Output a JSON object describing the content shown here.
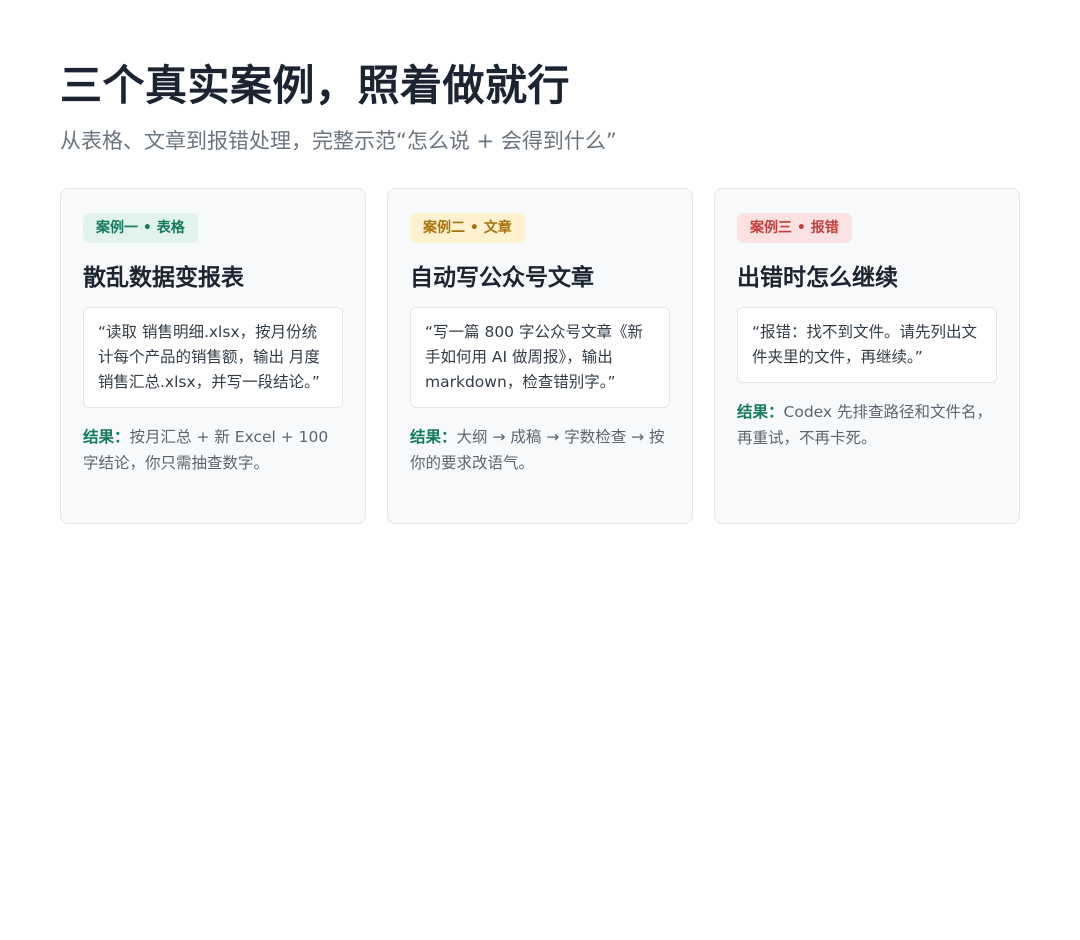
{
  "header": {
    "title": "三个真实案例，照着做就行",
    "subtitle": "从表格、文章到报错处理，完整示范“怎么说 + 会得到什么”"
  },
  "cards": [
    {
      "badge": "案例一 • 表格",
      "title": "散乱数据变报表",
      "quote": "“读取 销售明细.xlsx，按月份统计每个产品的销售额，输出 月度销售汇总.xlsx，并写一段结论。”",
      "result_label": "结果：",
      "result_text": "按月汇总 + 新 Excel + 100 字结论，你只需抽查数字。"
    },
    {
      "badge": "案例二 • 文章",
      "title": "自动写公众号文章",
      "quote": "“写一篇 800 字公众号文章《新手如何用 AI 做周报》，输出 markdown，检查错别字。”",
      "result_label": "结果：",
      "result_text": "大纲 → 成稿 → 字数检查 → 按你的要求改语气。"
    },
    {
      "badge": "案例三 • 报错",
      "title": "出错时怎么继续",
      "quote": "“报错：找不到文件。请先列出文件夹里的文件，再继续。”",
      "result_label": "结果：",
      "result_text": "Codex 先排查路径和文件名，再重试，不再卡死。"
    }
  ],
  "colors": {
    "case1": "#137a5c",
    "case2": "#a8740b",
    "case3": "#c2403d"
  }
}
